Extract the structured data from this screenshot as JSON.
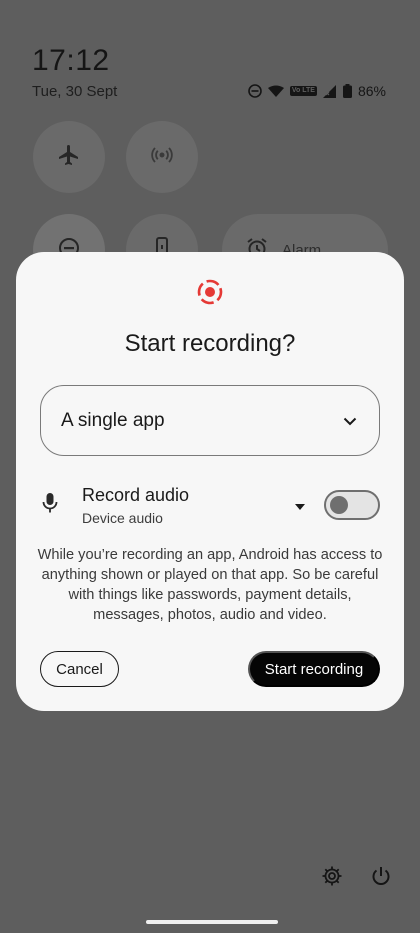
{
  "status": {
    "time": "17:12",
    "date": "Tue, 30 Sept",
    "volte_label": "Vo LTE",
    "battery": "86%"
  },
  "quick_settings": {
    "alarm_label": "Alarm",
    "tiles": [
      "airplane-mode",
      "hotspot",
      "do-not-disturb",
      "flashlight",
      "alarm"
    ]
  },
  "dialog": {
    "title": "Start recording?",
    "source_select": {
      "value": "A single app"
    },
    "audio": {
      "title": "Record audio",
      "subtitle": "Device audio",
      "enabled": false
    },
    "body": "While you’re recording an app, Android has access to anything shown or played on that app. So be careful with things like passwords, payment details, messages, photos, audio and video.",
    "cancel_label": "Cancel",
    "start_label": "Start recording"
  },
  "colors": {
    "accent_record": "#e53935",
    "scrim": "#5e5e5e",
    "dialog_bg": "#f7f7f7",
    "primary_button": "#050505"
  }
}
